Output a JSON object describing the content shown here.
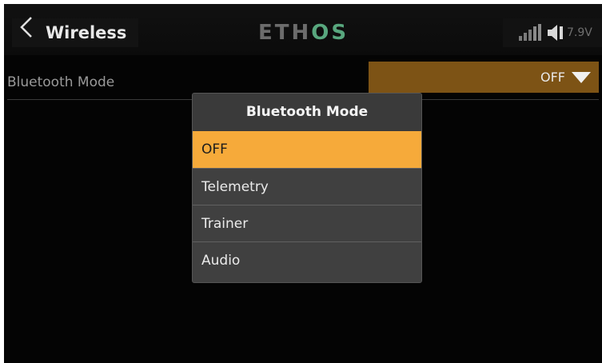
{
  "header": {
    "title": "Wireless",
    "logo_left": "ETH",
    "logo_right": "OS",
    "voltage": "7.9V"
  },
  "setting": {
    "label": "Bluetooth Mode",
    "value": "OFF"
  },
  "popup": {
    "title": "Bluetooth Mode",
    "options": [
      {
        "label": "OFF",
        "selected": true
      },
      {
        "label": "Telemetry",
        "selected": false
      },
      {
        "label": "Trainer",
        "selected": false
      },
      {
        "label": "Audio",
        "selected": false
      }
    ]
  },
  "colors": {
    "accent": "#f6aa3a",
    "select_bg": "#7d5315",
    "logo_os": "#58a77e"
  },
  "icons": [
    "back-chevron-icon",
    "signal-icon",
    "speaker-icon",
    "dropdown-triangle-icon"
  ]
}
